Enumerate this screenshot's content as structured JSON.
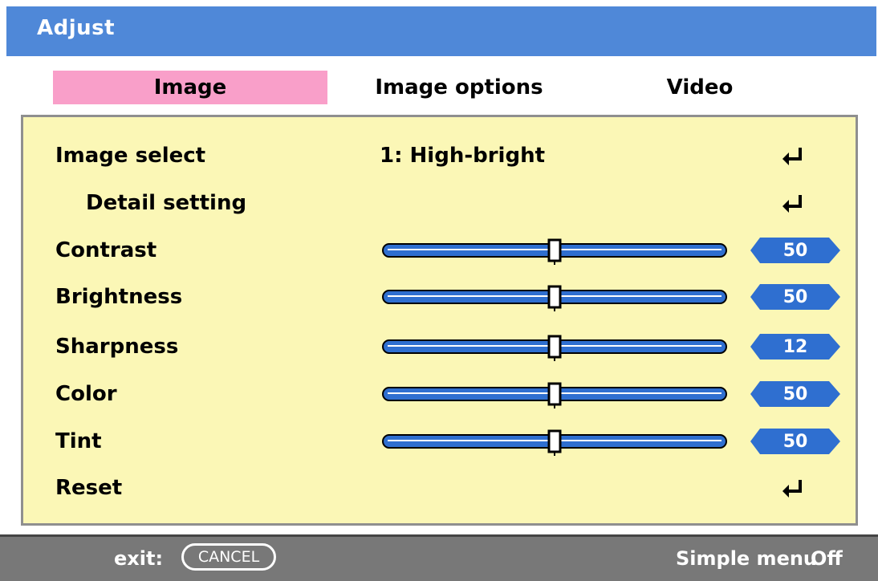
{
  "window": {
    "title": "Adjust"
  },
  "tabs": [
    {
      "label": "Image",
      "active": true
    },
    {
      "label": "Image options",
      "active": false
    },
    {
      "label": "Video",
      "active": false
    }
  ],
  "rows": {
    "image_select": {
      "label": "Image select",
      "value": "1: High-bright"
    },
    "detail_setting": {
      "label": "Detail setting"
    },
    "contrast": {
      "label": "Contrast",
      "value": "50",
      "level": 0.5
    },
    "brightness": {
      "label": "Brightness",
      "value": "50",
      "level": 0.5
    },
    "sharpness": {
      "label": "Sharpness",
      "value": "12",
      "level": 0.5
    },
    "color": {
      "label": "Color",
      "value": "50",
      "level": 0.5
    },
    "tint": {
      "label": "Tint",
      "value": "50",
      "level": 0.5
    },
    "reset": {
      "label": "Reset"
    }
  },
  "footer": {
    "exit_label": "exit:",
    "exit_key": "CANCEL",
    "simple_menu_label": "Simple menu",
    "simple_menu_value": "Off"
  },
  "colors": {
    "title_bar": "#4f88d8",
    "active_tab": "#f99fc9",
    "content_bg": "#fbf7b6",
    "footer_bg": "#787878",
    "badge": "#2f6fd0"
  },
  "icons": {
    "enter": "enter-return-icon"
  }
}
